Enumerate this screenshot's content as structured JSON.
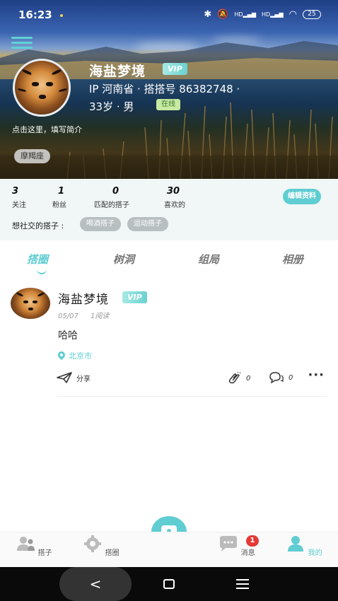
{
  "status_bar": {
    "time": "16:23",
    "battery": "25",
    "signal_label_1": "HD",
    "signal_label_2": "HD"
  },
  "profile": {
    "nickname": "海盐梦境",
    "vip_label": "VIP",
    "ip_line": "IP 河南省 · 搭搭号 86382748 ·",
    "age_gender": "33岁 · 男",
    "online_label": "在线",
    "intro_prompt": "点击这里，填写简介",
    "zodiac": "摩羯座"
  },
  "stats": [
    {
      "value": "3",
      "label": "关注"
    },
    {
      "value": "1",
      "label": "粉丝"
    },
    {
      "value": "0",
      "label": "匹配的搭子"
    },
    {
      "value": "30",
      "label": "喜欢的"
    }
  ],
  "edit_button": "编辑资料",
  "social": {
    "label": "想社交的搭子 :",
    "chips": [
      "喝酒搭子",
      "运动搭子"
    ]
  },
  "tabs": [
    {
      "label": "搭圈",
      "active": true
    },
    {
      "label": "树洞",
      "active": false
    },
    {
      "label": "组局",
      "active": false
    },
    {
      "label": "相册",
      "active": false
    }
  ],
  "post": {
    "author": "海盐梦境",
    "vip_label": "VIP",
    "date": "05/07",
    "reads": "1阅读",
    "text": "哈哈",
    "location": "北京市",
    "share_label": "分享",
    "claps": "0",
    "comments": "0",
    "more": "···"
  },
  "bottom_nav": [
    {
      "label": "搭子",
      "active": false
    },
    {
      "label": "搭圈",
      "active": false
    },
    {
      "label": "消息",
      "active": false
    },
    {
      "label": "我的",
      "active": true
    }
  ],
  "message_badge": "1",
  "system_nav": {
    "back": "<"
  },
  "colors": {
    "accent": "#5fcdd2",
    "vip": "#6ad1cf",
    "badge": "#e53935"
  }
}
